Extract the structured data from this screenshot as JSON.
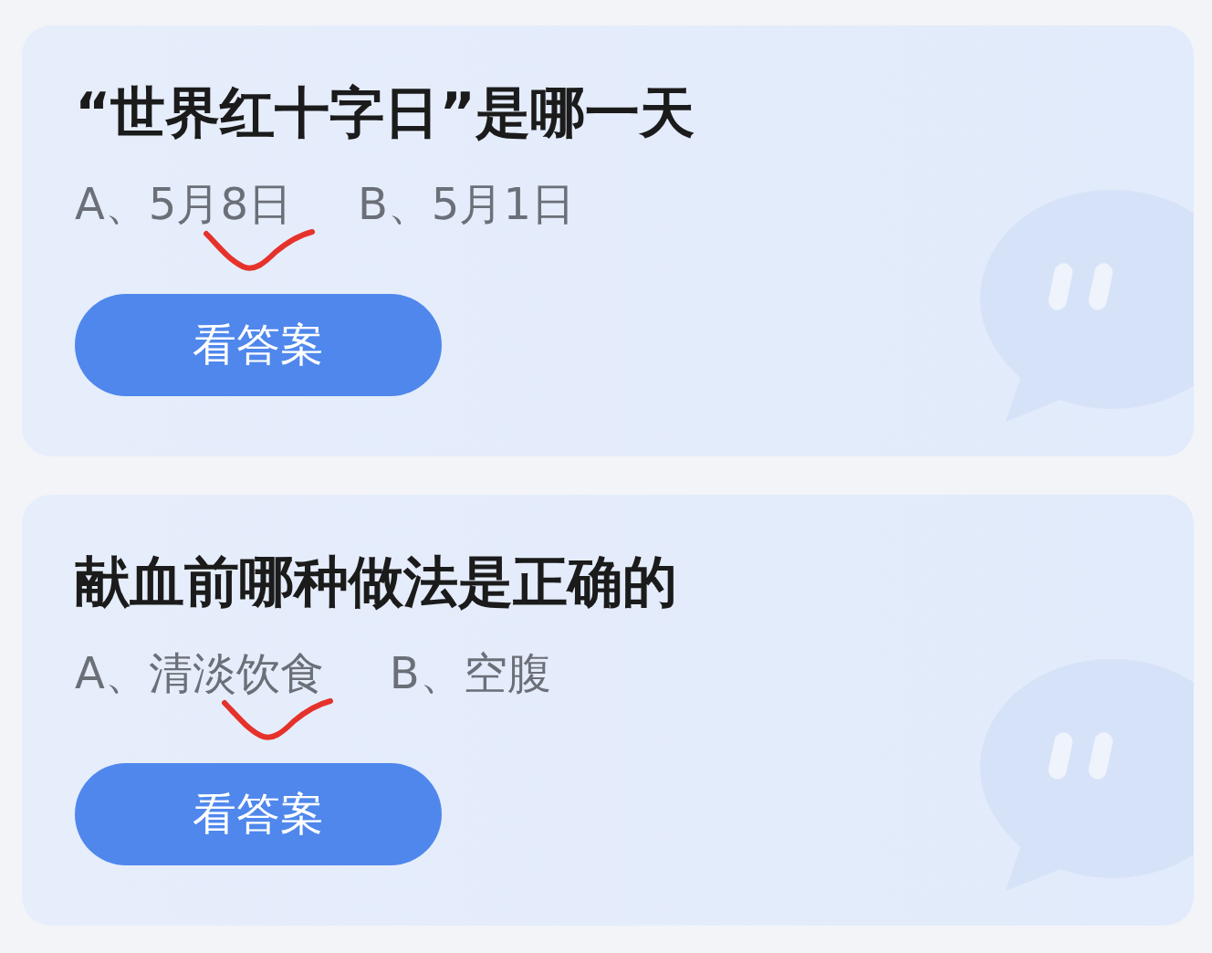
{
  "cards": [
    {
      "question": "“世界红十字日”是哪一天",
      "options": [
        {
          "text": "A、5月8日",
          "marked": true
        },
        {
          "text": "B、5月1日",
          "marked": false
        }
      ],
      "button": "看答案"
    },
    {
      "question": "献血前哪种做法是正确的",
      "options": [
        {
          "text": "A、清淡饮食",
          "marked": true
        },
        {
          "text": "B、空腹",
          "marked": false
        }
      ],
      "button": "看答案"
    }
  ]
}
